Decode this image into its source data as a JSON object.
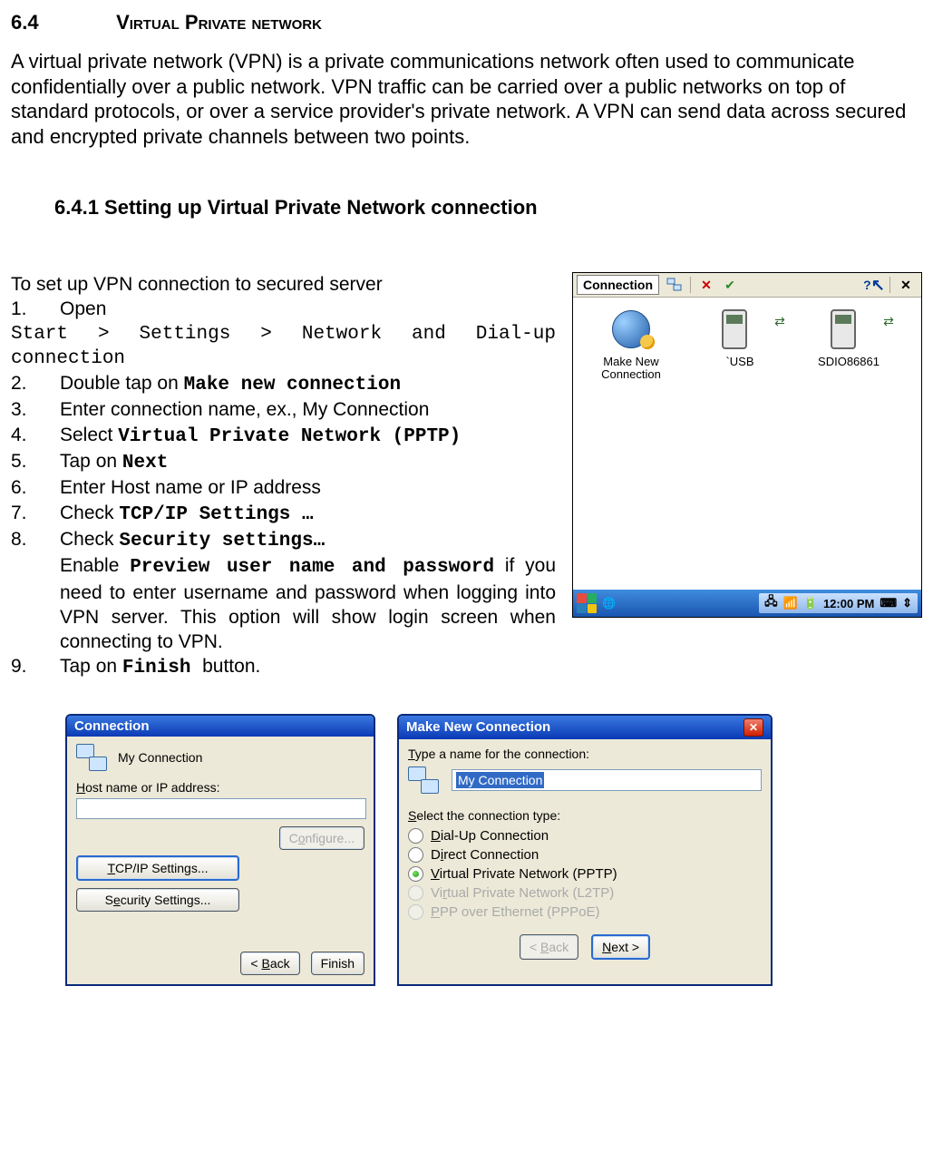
{
  "section": {
    "number": "6.4",
    "title": "Virtual Private network"
  },
  "intro": "A virtual private network (VPN) is a private communications network often used to communicate confidentially over a public network. VPN traffic can be carried over a public networks on top of standard protocols, or over a service provider's private network. A VPN can send data across secured and encrypted private channels between two points.",
  "subsection": "6.4.1 Setting up Virtual Private Network connection",
  "instructions": {
    "lead": "To set up VPN connection to secured server",
    "s1_num": "1.",
    "s1_text": "Open",
    "s1_path": "Start > Settings > Network and Dial-up connection",
    "s2_num": "2.",
    "s2_pre": "Double tap on ",
    "s2_code": "Make new connection",
    "s3_num": "3.",
    "s3_text": "Enter connection name, ex., My Connection",
    "s4_num": "4.",
    "s4_pre": "Select ",
    "s4_code": "Virtual Private Network (PPTP)",
    "s5_num": "5.",
    "s5_pre": "Tap on ",
    "s5_code": "Next",
    "s6_num": "6.",
    "s6_text": "Enter Host name or IP address",
    "s7_num": "7.",
    "s7_pre": "Check ",
    "s7_code": "TCP/IP Settings …",
    "s8_num": "8.",
    "s8_pre": "Check ",
    "s8_code": "Security settings…",
    "s8_enable_pre": "Enable ",
    "s8_enable_code": "Preview user name and password",
    "s8_enable_post": " if you need to enter username and password when logging into VPN server. This option will show login screen when connecting to VPN.",
    "s9_num": "9.",
    "s9_pre": "Tap on ",
    "s9_code": " Finish ",
    "s9_post": " button."
  },
  "connWin": {
    "label": "Connection",
    "items": {
      "makeNew": "Make New Connection",
      "usb": "`USB",
      "sdio": "SDIO86861"
    },
    "time": "12:00 PM"
  },
  "winA": {
    "title": "Connection",
    "name": "My Connection",
    "hostLabel_pre": "H",
    "hostLabel_rest": "ost name or IP address:",
    "hostValue": "",
    "configure": "Configure...",
    "tcp_pre": "T",
    "tcp_rest": "CP/IP Settings...",
    "sec_pre": "S",
    "sec_mid": "e",
    "sec_rest": "curity Settings...",
    "back": "< Back",
    "back_u": "B",
    "finish": "Finish"
  },
  "winB": {
    "title": "Make New Connection",
    "typeLabel_pre": "T",
    "typeLabel_rest": "ype a name for the connection:",
    "nameValue": "My Connection",
    "selectLabel_pre": "S",
    "selectLabel_rest": "elect the connection type:",
    "opts": {
      "dial_pre": "D",
      "dial_rest": "ial-Up Connection",
      "direct_pre": "D",
      "direct_mid": "i",
      "direct_rest": "rect Connection",
      "vpn_pre": "V",
      "vpn_rest": "irtual Private Network (PPTP)",
      "l2tp_pre": "Vi",
      "l2tp_mid": "r",
      "l2tp_rest": "tual Private Network (L2TP)",
      "pppoe_pre": "P",
      "pppoe_rest": "PP over Ethernet (PPPoE)"
    },
    "back": "< Back",
    "next_pre": "N",
    "next_rest": "ext >"
  }
}
